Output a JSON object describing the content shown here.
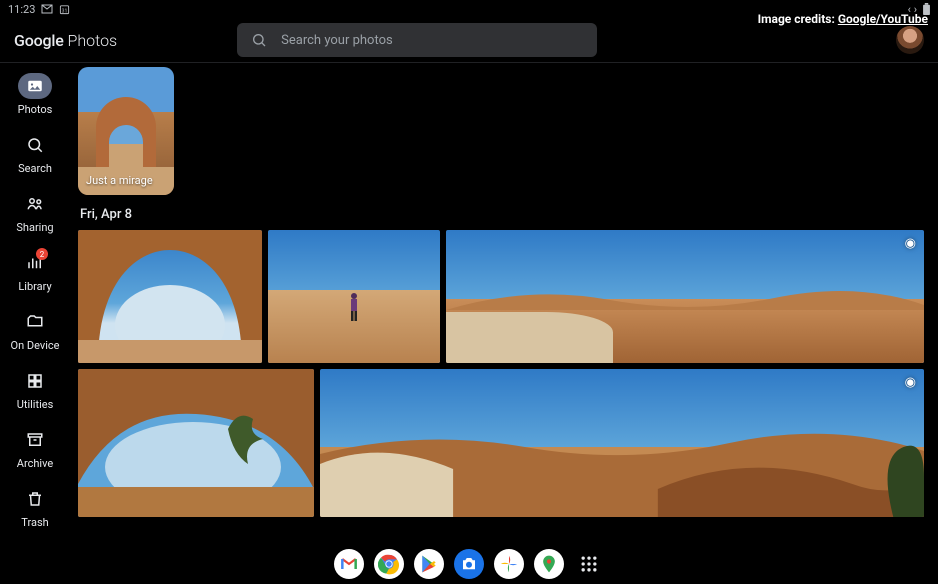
{
  "status": {
    "time": "11:23"
  },
  "credits": {
    "pre": "Image credits: ",
    "link": "Google/YouTube"
  },
  "header": {
    "logo_google": "Google",
    "logo_photos": " Photos",
    "search_placeholder": "Search your photos"
  },
  "sidebar": {
    "photos": "Photos",
    "search": "Search",
    "sharing": "Sharing",
    "library": "Library",
    "library_badge": "2",
    "ondevice": "On Device",
    "utilities": "Utilities",
    "archive": "Archive",
    "trash": "Trash"
  },
  "memories": {
    "item1_title": "Just a mirage"
  },
  "sections": {
    "date1": "Fri, Apr 8"
  },
  "dock": {
    "apps": [
      "gmail",
      "chrome",
      "play",
      "camera",
      "photos",
      "maps",
      "allapps"
    ]
  }
}
